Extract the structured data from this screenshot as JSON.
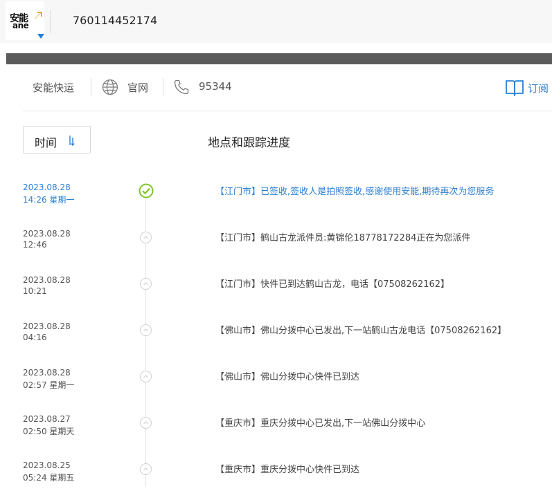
{
  "header": {
    "logo_cn": "安能",
    "logo_en": "ane",
    "tracking_number": "760114452174"
  },
  "info": {
    "company": "安能快运",
    "site_label": "官网",
    "phone": "95344",
    "subscribe_label": "订阅"
  },
  "table": {
    "sort_label": "时间",
    "column_title": "地点和跟踪进度"
  },
  "events": [
    {
      "date": "2023.08.28",
      "time": "14:26 星期一",
      "desc": "【江门市】已签收,签收人是拍照签收,感谢使用安能,期待再次为您服务"
    },
    {
      "date": "2023.08.28",
      "time": "12:46",
      "desc": "【江门市】鹤山古龙派件员:黄锦伦18778172284正在为您派件"
    },
    {
      "date": "2023.08.28",
      "time": "10:21",
      "desc": "【江门市】快件已到达鹤山古龙，电话【07508262162】"
    },
    {
      "date": "2023.08.28",
      "time": "04:16",
      "desc": "【佛山市】佛山分拨中心已发出,下一站鹤山古龙电话【07508262162】"
    },
    {
      "date": "2023.08.28",
      "time": "02:57 星期一",
      "desc": "【佛山市】佛山分拨中心快件已到达"
    },
    {
      "date": "2023.08.27",
      "time": "02:50 星期天",
      "desc": "【重庆市】重庆分拨中心已发出,下一站佛山分拨中心"
    },
    {
      "date": "2023.08.25",
      "time": "05:24 星期五",
      "desc": "【重庆市】重庆分拨中心快件已到达"
    }
  ],
  "colors": {
    "accent": "#2a7fd4",
    "success": "#7cc625"
  }
}
